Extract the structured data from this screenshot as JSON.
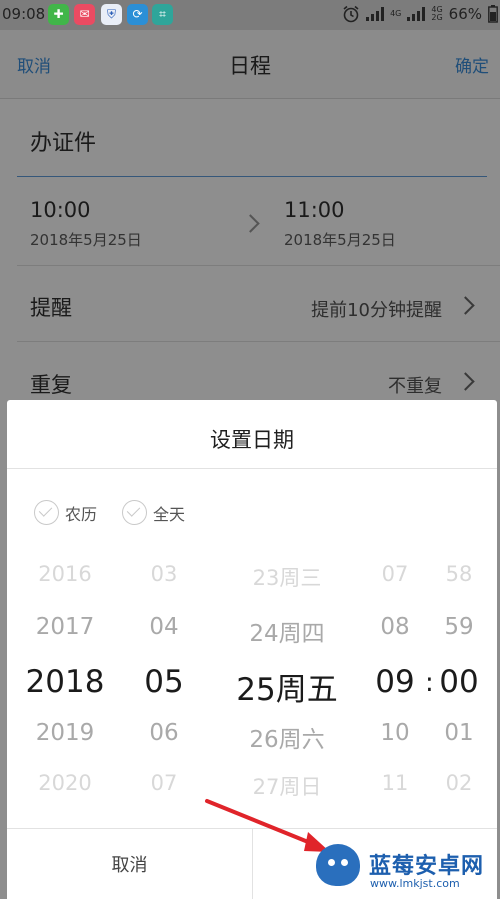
{
  "status_bar": {
    "time": "09:08",
    "app_icons": [
      {
        "icon": "shield-plus-icon",
        "color": "#41b649",
        "glyph": "✚"
      },
      {
        "icon": "mail-icon",
        "color": "#ea4b62",
        "glyph": "✉"
      },
      {
        "icon": "shield-icon",
        "color": "#e9eef7",
        "glyph": "⛨"
      },
      {
        "icon": "sync-icon",
        "color": "#2b8fd6",
        "glyph": "⟳"
      },
      {
        "icon": "scan-icon",
        "color": "#2fa59a",
        "glyph": "⌗"
      }
    ],
    "alarm_icon": "alarm-icon",
    "network_1": "4G",
    "network_2": "4G",
    "network_2b": "2G",
    "battery": "66%",
    "battery_icon": "battery-icon"
  },
  "nav": {
    "cancel": "取消",
    "title": "日程",
    "confirm": "确定"
  },
  "event": {
    "title": "办证件",
    "start_time": "10:00",
    "start_date": "2018年5月25日",
    "end_time": "11:00",
    "end_date": "2018年5月25日",
    "reminder_label": "提醒",
    "reminder_value": "提前10分钟提醒",
    "repeat_label": "重复",
    "repeat_value": "不重复"
  },
  "dialog": {
    "title": "设置日期",
    "options": [
      "农历",
      "全天"
    ],
    "wheels": {
      "year": [
        "2016",
        "2017",
        "2018",
        "2019",
        "2020"
      ],
      "month": [
        "03",
        "04",
        "05",
        "06",
        "07"
      ],
      "day": [
        "23周三",
        "24周四",
        "25周五",
        "26周六",
        "27周日"
      ],
      "hour": [
        "07",
        "08",
        "09",
        "10",
        "11"
      ],
      "minute": [
        "58",
        "59",
        "00",
        "01",
        "02"
      ]
    },
    "separator": ":",
    "footer_cancel": "取消"
  },
  "watermark": {
    "name": "蓝莓安卓网",
    "url": "www.lmkjst.com"
  },
  "colors": {
    "accent_blue": "#1f4e79",
    "annotation_red": "#e0242a",
    "watermark_blue": "#1d5fae"
  }
}
